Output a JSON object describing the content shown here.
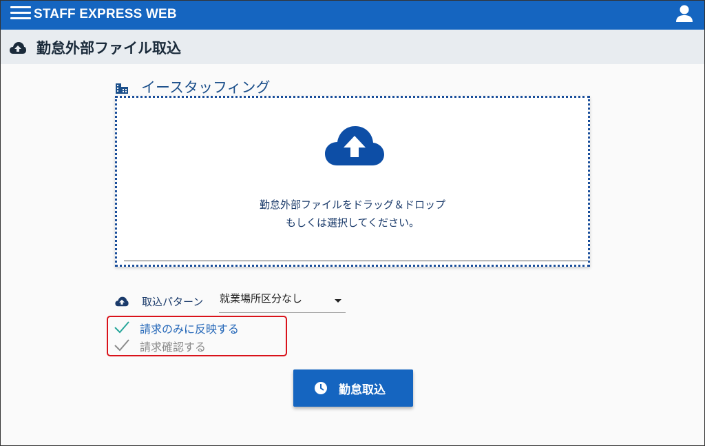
{
  "app": {
    "title": "STAFF EXPRESS WEB"
  },
  "page": {
    "title": "勤怠外部ファイル取込"
  },
  "section": {
    "label": "イースタッフィング"
  },
  "dropzone": {
    "line1": "勤怠外部ファイルをドラッグ＆ドロップ",
    "line2": "もしくは選択してください。"
  },
  "pattern": {
    "label": "取込パターン",
    "selected": "就業場所区分なし"
  },
  "checks": [
    {
      "label": "請求のみに反映する",
      "checked": true
    },
    {
      "label": "請求確認する",
      "checked": false
    }
  ],
  "action": {
    "label": "勤怠取込"
  },
  "colors": {
    "brand": "#1565c0",
    "highlight_border": "#d9121a",
    "check_active": "#26a69a",
    "check_inactive": "#8a8a8a"
  },
  "icons": {
    "menu": "hamburger-menu-icon",
    "user": "user-icon",
    "upload": "cloud-upload-icon",
    "building": "building-icon",
    "check": "check-icon",
    "clock": "clock-icon"
  }
}
